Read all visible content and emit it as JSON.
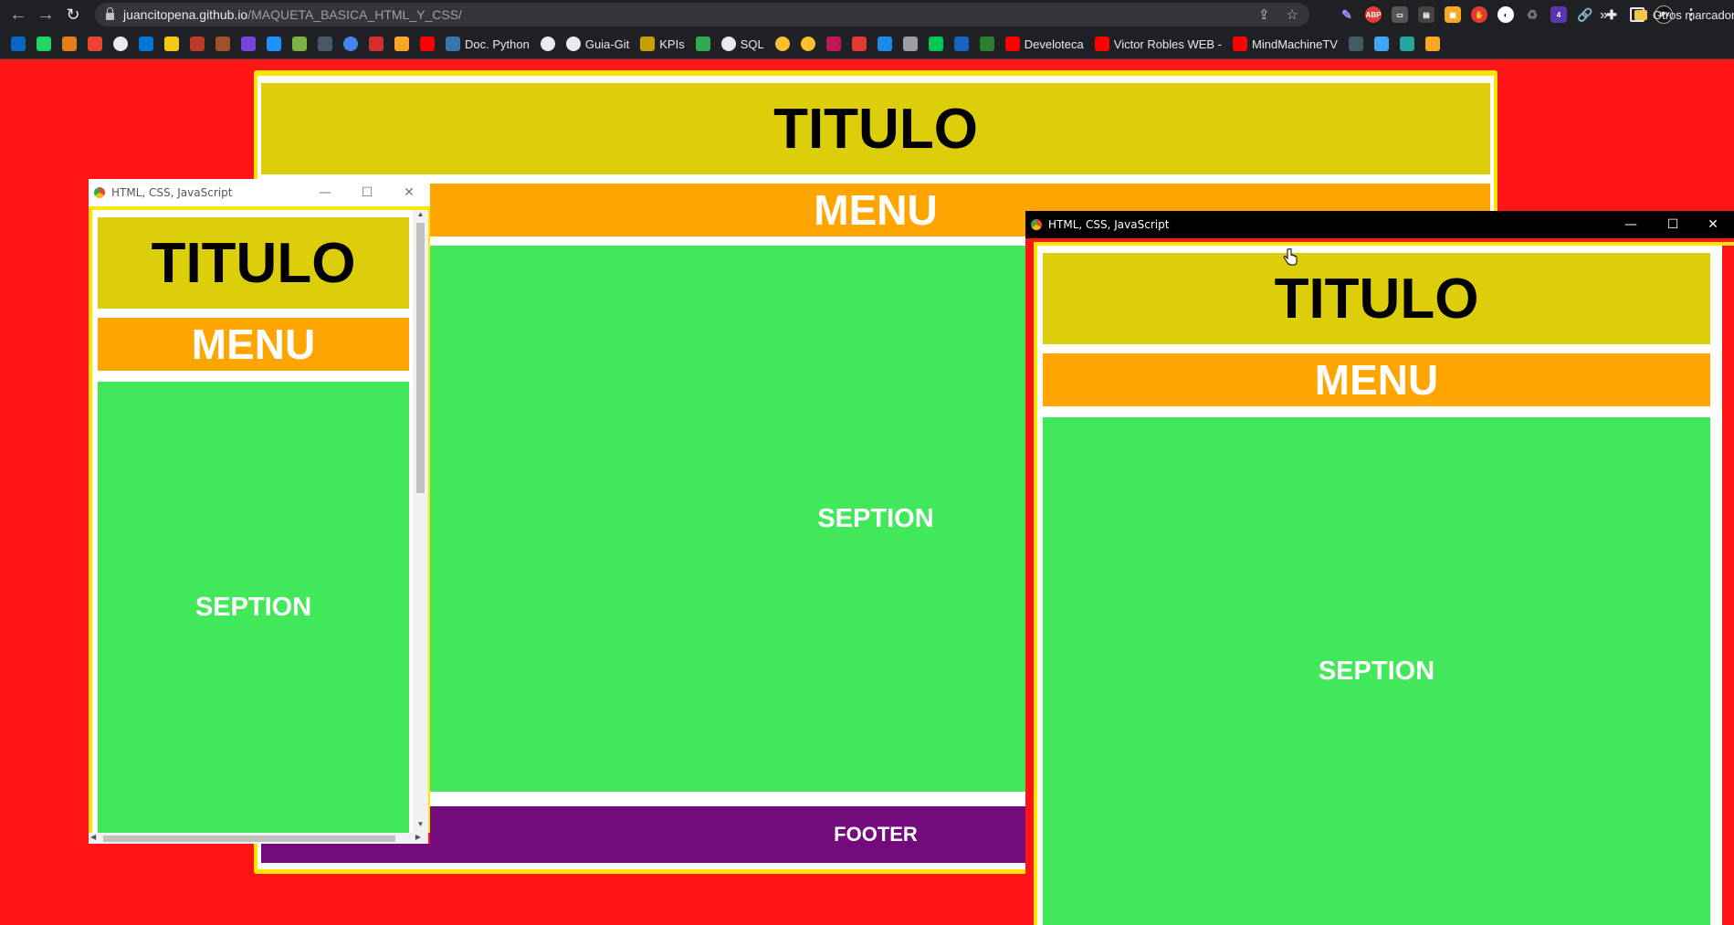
{
  "browser": {
    "url_host": "juancitopena.github.io",
    "url_path": "/MAQUETA_BASICA_HTML_Y_CSS/",
    "bookmarks": [
      {
        "label": "",
        "icon": "linkedin-icon",
        "color": "#0a66c2"
      },
      {
        "label": "",
        "icon": "whatsapp-icon",
        "color": "#25d366"
      },
      {
        "label": "",
        "icon": "shield-icon",
        "color": "#e37e1a"
      },
      {
        "label": "",
        "icon": "gmail-icon",
        "color": "#ea4335"
      },
      {
        "label": "",
        "icon": "globe-icon",
        "color": "#e8eaed"
      },
      {
        "label": "",
        "icon": "outlook-icon",
        "color": "#0078d4"
      },
      {
        "label": "",
        "icon": "powerbi-icon",
        "color": "#f2c811"
      },
      {
        "label": "",
        "icon": "bottle-icon",
        "color": "#c0392b"
      },
      {
        "label": "",
        "icon": "bottle-icon",
        "color": "#a0522d"
      },
      {
        "label": "",
        "icon": "u-icon",
        "color": "#7b3fe4"
      },
      {
        "label": "",
        "icon": "leaf-icon",
        "color": "#1e90ff"
      },
      {
        "label": "",
        "icon": "diamond-icon",
        "color": "#7cb342"
      },
      {
        "label": "",
        "icon": "terminal-icon",
        "color": "#455a64"
      },
      {
        "label": "",
        "icon": "circle-icon",
        "color": "#4285f4"
      },
      {
        "label": "",
        "icon": "rb-icon",
        "color": "#d32f2f"
      },
      {
        "label": "",
        "icon": "bank-icon",
        "color": "#f9a825"
      },
      {
        "label": "",
        "icon": "youtube-icon",
        "color": "#ff0000"
      },
      {
        "label": "Doc. Python",
        "icon": "python-icon",
        "color": "#3776ab"
      },
      {
        "label": "",
        "icon": "globe-icon",
        "color": "#e8eaed"
      },
      {
        "label": "Guia-Git",
        "icon": "globe-icon",
        "color": "#e8eaed"
      },
      {
        "label": "KPIs",
        "icon": "kpi-icon",
        "color": "#c5a000"
      },
      {
        "label": "",
        "icon": "maps-icon",
        "color": "#34a853"
      },
      {
        "label": "SQL",
        "icon": "globe-icon",
        "color": "#e8eaed"
      },
      {
        "label": "",
        "icon": "emoji-icon",
        "color": "#fbc02d"
      },
      {
        "label": "",
        "icon": "emoji-icon",
        "color": "#fbc02d"
      },
      {
        "label": "",
        "icon": "app-icon",
        "color": "#c2185b"
      },
      {
        "label": "",
        "icon": "grid-icon",
        "color": "#e53935"
      },
      {
        "label": "",
        "icon": "h-icon",
        "color": "#1e88e5"
      },
      {
        "label": "",
        "icon": "dot-icon",
        "color": "#9e9e9e"
      },
      {
        "label": "",
        "icon": "v-icon",
        "color": "#00c853"
      },
      {
        "label": "",
        "icon": "gear-icon",
        "color": "#1565c0"
      },
      {
        "label": "",
        "icon": "w-icon",
        "color": "#2e7d32"
      },
      {
        "label": "Develoteca",
        "icon": "youtube-icon",
        "color": "#ff0000"
      },
      {
        "label": "Victor Robles WEB -",
        "icon": "youtube-icon",
        "color": "#ff0000"
      },
      {
        "label": "MindMachineTV",
        "icon": "youtube-icon",
        "color": "#ff0000"
      },
      {
        "label": "",
        "icon": "shield-icon",
        "color": "#455a64"
      },
      {
        "label": "",
        "icon": "star-icon",
        "color": "#42a5f5"
      },
      {
        "label": "",
        "icon": "m-icon",
        "color": "#26a69a"
      },
      {
        "label": "",
        "icon": "triangle-icon",
        "color": "#f9a825"
      }
    ],
    "more_label": "»",
    "other_bookmarks": "Otros marcadores"
  },
  "page": {
    "titulo": "TITULO",
    "menu": "MENU",
    "seption": "SEPTION",
    "footer": "FOOTER"
  },
  "popup_left": {
    "title": "HTML, CSS, JavaScript"
  },
  "popup_right": {
    "title": "HTML, CSS, JavaScript"
  },
  "colors": {
    "background": "#ff1515",
    "border": "#ffe600",
    "titulo": "#dcce0a",
    "menu": "#ffa500",
    "seption": "#41e85a",
    "footer": "#740b7c"
  }
}
